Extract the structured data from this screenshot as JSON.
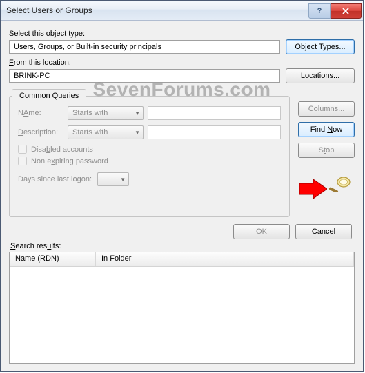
{
  "window": {
    "title": "Select Users or Groups"
  },
  "section1": {
    "object_type_label": "Select this object type:",
    "object_type_value": "Users, Groups, or Built-in security principals",
    "object_types_btn": "Object Types...",
    "location_label": "From this location:",
    "location_value": "BRINK-PC",
    "locations_btn": "Locations..."
  },
  "queries": {
    "tab_label": "Common Queries",
    "name_label": "Name:",
    "name_mode": "Starts with",
    "name_value": "",
    "desc_label": "Description:",
    "desc_mode": "Starts with",
    "desc_value": "",
    "chk_disabled": "Disabled accounts",
    "chk_nonexp": "Non expiring password",
    "days_label": "Days since last logon:",
    "days_value": ""
  },
  "side": {
    "columns_btn": "Columns...",
    "find_now_btn_pre": "Find ",
    "find_now_btn_u": "N",
    "find_now_btn_post": "ow",
    "stop_btn": "Stop"
  },
  "dlg": {
    "ok": "OK",
    "cancel": "Cancel"
  },
  "results": {
    "label": "Search results:",
    "col1": "Name (RDN)",
    "col2": "In Folder"
  },
  "watermark": "SevenForums.com",
  "underlines": {
    "s": "S",
    "o": "O",
    "f": "F",
    "l": "L",
    "a": "A",
    "e": "e",
    "i": "i",
    "y": "y",
    "d": "D",
    "c": "C",
    "t": "t"
  }
}
